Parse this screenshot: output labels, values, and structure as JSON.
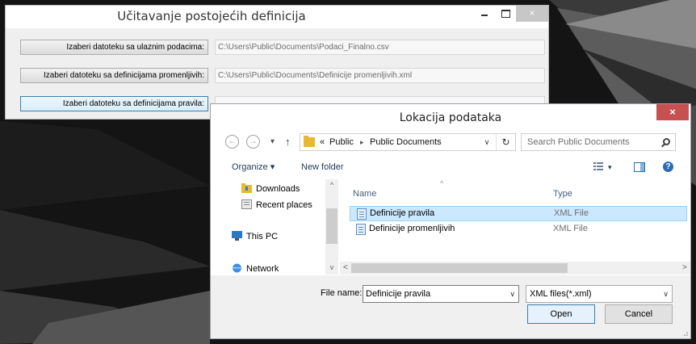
{
  "main_window": {
    "title": "Učitavanje postojećih definicija",
    "rows": [
      {
        "button_label": "Izaberi datoteku sa ulaznim podacima:",
        "path": "C:\\Users\\Public\\Documents\\Podaci_Finalno.csv"
      },
      {
        "button_label": "Izaberi datoteku sa definicijama promenljivih:",
        "path": "C:\\Users\\Public\\Documents\\Definicije promenljivih.xml"
      },
      {
        "button_label": "Izaberi datoteku sa definicijama pravila:",
        "path": ""
      }
    ]
  },
  "dialog": {
    "title": "Lokacija podataka",
    "close_glyph": "×",
    "nav": {
      "back": "←",
      "forward": "→",
      "recent": "▾",
      "up": "↑"
    },
    "address": {
      "overflow": "«",
      "crumbs": [
        "Public",
        "Public Documents"
      ],
      "separator": "▸",
      "dropdown": "∨",
      "refresh": "↻"
    },
    "search_placeholder": "Search Public Documents",
    "toolbar": {
      "organize": "Organize ▾",
      "new_folder": "New folder",
      "view_dropdown": "▾",
      "help": "?"
    },
    "nav_pane": {
      "items": [
        "Downloads",
        "Recent places",
        "This PC",
        "Network"
      ],
      "scroll_up": "^",
      "scroll_down": "v"
    },
    "columns": {
      "name": "Name",
      "type": "Type",
      "sort_caret": "^"
    },
    "files": [
      {
        "name": "Definicije pravila",
        "type": "XML File",
        "selected": true
      },
      {
        "name": "Definicije promenljivih",
        "type": "XML File",
        "selected": false
      }
    ],
    "hscroll": {
      "left": "<",
      "right": ">"
    },
    "file_name_label": "File name:",
    "file_name_value": "Definicije pravila",
    "dropdown_arrow": "∨",
    "file_type_value": "XML files(*.xml)",
    "open_label": "Open",
    "cancel_label": "Cancel"
  },
  "colors": {
    "selection": "#cce8ff",
    "close_red": "#c75050",
    "accent_blue": "#3c7fb1"
  }
}
